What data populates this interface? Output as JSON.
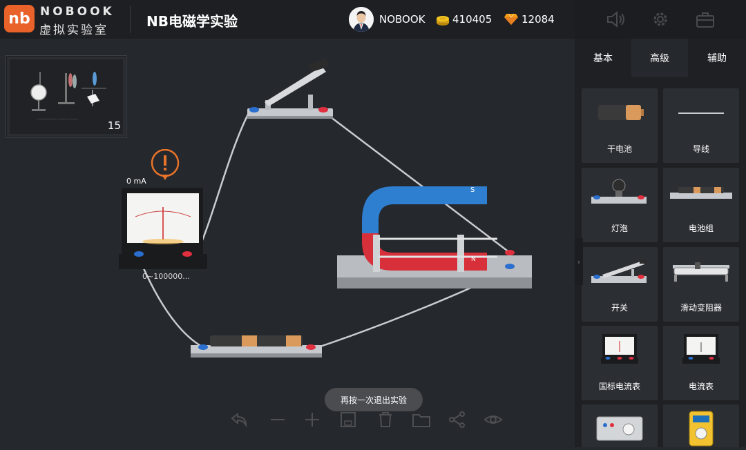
{
  "brand": {
    "logo_mark": "nb",
    "name_en": "NOBOOK",
    "name_cn": "虚拟实验室"
  },
  "header": {
    "app_title": "NB电磁学实验",
    "user_name": "NOBOOK",
    "coins": "410405",
    "gems": "12084",
    "icons": [
      "speaker-icon",
      "gear-icon",
      "toolbox-icon"
    ]
  },
  "thumbnail": {
    "count": "15"
  },
  "canvas": {
    "ammeter_reading": "0 mA",
    "ammeter_range": "0~100000..."
  },
  "panel": {
    "tabs": [
      "基本",
      "高级",
      "辅助"
    ],
    "active_tab": "高级",
    "items": [
      {
        "label": "干电池",
        "icon": "dry-battery-icon"
      },
      {
        "label": "导线",
        "icon": "wire-icon"
      },
      {
        "label": "灯泡",
        "icon": "bulb-icon"
      },
      {
        "label": "电池组",
        "icon": "battery-pack-icon"
      },
      {
        "label": "开关",
        "icon": "switch-icon"
      },
      {
        "label": "滑动变阻器",
        "icon": "rheostat-icon"
      },
      {
        "label": "国标电流表",
        "icon": "standard-ammeter-icon"
      },
      {
        "label": "电流表",
        "icon": "ammeter-icon"
      },
      {
        "label": "",
        "icon": "power-supply-icon"
      },
      {
        "label": "",
        "icon": "multimeter-icon"
      }
    ]
  },
  "toast": {
    "message": "再按一次退出实验"
  },
  "toolbar": {
    "icons": [
      "undo-icon",
      "minus-icon",
      "add-icon",
      "save-icon",
      "delete-icon",
      "folder-icon",
      "share-icon",
      "eye-icon"
    ]
  },
  "colors": {
    "brand_orange": "#e8622a",
    "magnet_blue": "#2f7fd0",
    "magnet_red": "#d8303a",
    "background": "#25282c",
    "panel": "#1e2023"
  }
}
